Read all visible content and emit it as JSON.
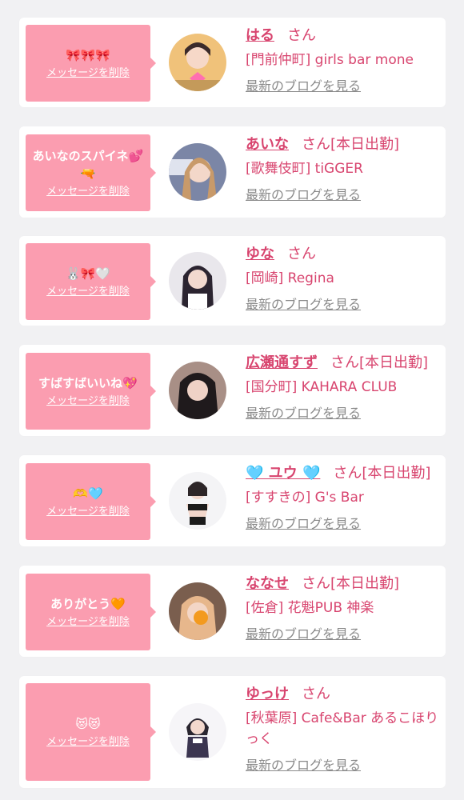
{
  "delete_label": "メッセージを削除",
  "blog_label": "最新のブログを見る",
  "cards": [
    {
      "message": "🎀🎀🎀",
      "name": "はる",
      "honorific": "さん",
      "status": "",
      "shop": "[門前仲町] girls bar mone"
    },
    {
      "message": "あいなのスパイネ💕🔫",
      "name": "あいな",
      "honorific": "さん",
      "status": "[本日出勤]",
      "shop": "[歌舞伎町] tiGGER"
    },
    {
      "message": "🐰🎀🤍",
      "name": "ゆな",
      "honorific": "さん",
      "status": "",
      "shop": "[岡崎] Regina"
    },
    {
      "message": "すばすばいいね💖",
      "name": "広瀬通すず",
      "honorific": "さん",
      "status": "[本日出勤]",
      "shop": "[国分町] KAHARA CLUB"
    },
    {
      "message": "🫶🩵",
      "name": "🩵 ユウ 🩵",
      "honorific": "さん",
      "status": "[本日出勤]",
      "shop": "[すすきの] G's Bar"
    },
    {
      "message": "ありがとう🧡",
      "name": "ななせ",
      "honorific": "さん",
      "status": "[本日出勤]",
      "shop": "[佐倉] 花魁PUB 神楽"
    },
    {
      "message": "😻😻",
      "name": "ゆっけ",
      "honorific": "さん",
      "status": "",
      "shop": "[秋葉原] Cafe&Bar あるこほりっく"
    }
  ]
}
